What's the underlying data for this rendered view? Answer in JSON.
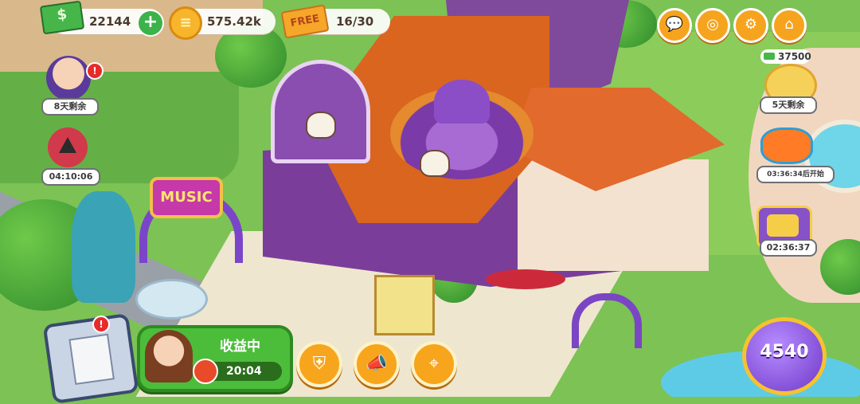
{
  "hud": {
    "cash": {
      "value": "22144",
      "icon": "cash-icon",
      "add_icon": "plus-icon"
    },
    "coins": {
      "value": "575.42k",
      "icon": "coin-icon",
      "icon_glyph": "≡"
    },
    "free_tickets": {
      "icon_text": "FREE",
      "value": "16/30"
    }
  },
  "top_right_buttons": [
    {
      "name": "chat-button",
      "icon": "chat-icon",
      "glyph": "💬"
    },
    {
      "name": "camera-button",
      "icon": "camera-icon",
      "glyph": "◎"
    },
    {
      "name": "settings-button",
      "icon": "gear-icon",
      "glyph": "⚙"
    },
    {
      "name": "home-button",
      "icon": "home-icon",
      "glyph": "⌂"
    }
  ],
  "left_events": [
    {
      "name": "witch-event",
      "label": "8天剩余",
      "badge": "!"
    },
    {
      "name": "triangle-event",
      "label": "04:10:06"
    }
  ],
  "right_events": [
    {
      "name": "piggy-bank-event",
      "cash": "37500",
      "label": "5天剩余"
    },
    {
      "name": "goggles-event",
      "label": "03:36:34后开始"
    },
    {
      "name": "mystery-box-event",
      "label": "02:36:37"
    }
  ],
  "bottom_bar": {
    "task_badge": "!",
    "earnings": {
      "title": "收益中",
      "timer": "20:04"
    },
    "buttons": [
      {
        "name": "badge-button",
        "icon": "shield-icon",
        "glyph": "⛨"
      },
      {
        "name": "megaphone-button",
        "icon": "megaphone-icon",
        "glyph": "📣"
      },
      {
        "name": "map-button",
        "icon": "map-pin-icon",
        "glyph": "⌖"
      }
    ],
    "gems": {
      "value": "4540"
    }
  },
  "scene": {
    "music_sign": "MUSIC"
  },
  "colors": {
    "accent_orange": "#f7a51d",
    "hud_green": "#4cbd3b",
    "gem_purple": "#6e38c8",
    "badge_red": "#e82a2a"
  }
}
